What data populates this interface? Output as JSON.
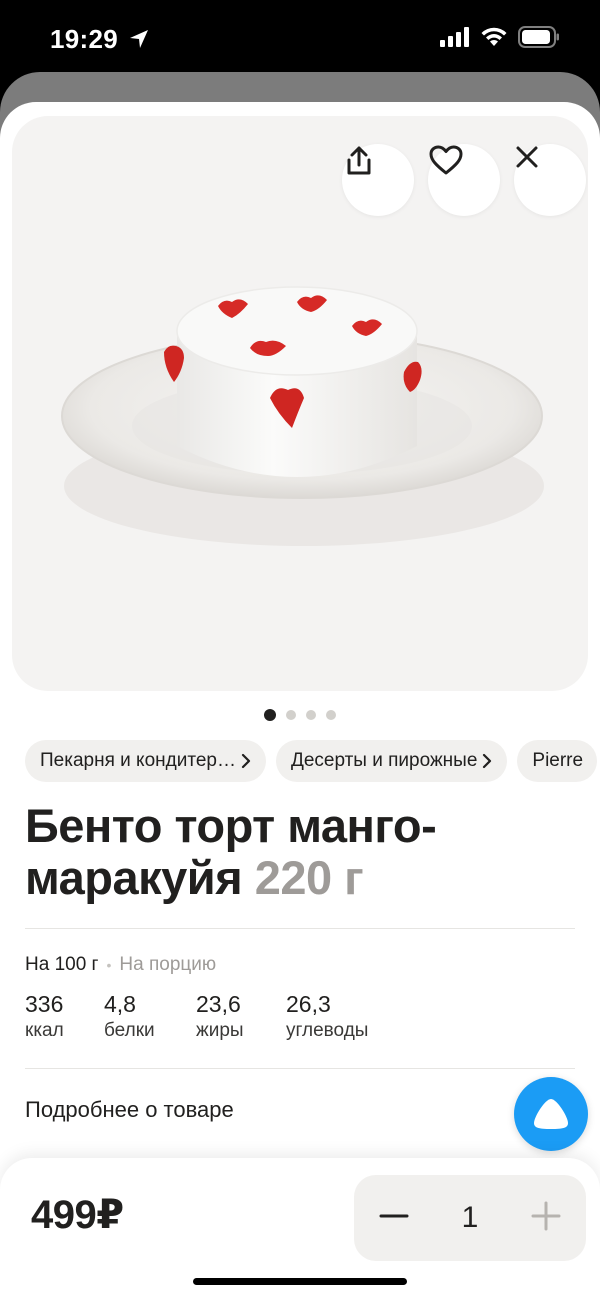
{
  "status": {
    "time": "19:29"
  },
  "product": {
    "breadcrumbs": [
      "Пекарня и кондитер…",
      "Десерты и пирожные",
      "Pierre"
    ],
    "title": "Бенто торт манго-маракуйя",
    "weight": "220 г",
    "pager": {
      "count": 4,
      "active": 1
    }
  },
  "nutrition": {
    "tab_active": "На 100 г",
    "tab_inactive": "На порцию",
    "items": [
      {
        "value": "336",
        "label": "ккал"
      },
      {
        "value": "4,8",
        "label": "белки"
      },
      {
        "value": "23,6",
        "label": "жиры"
      },
      {
        "value": "26,3",
        "label": "углеводы"
      }
    ]
  },
  "details_link": "Подробнее о товаре",
  "cart": {
    "price": "499₽",
    "quantity": "1"
  },
  "icons": [
    "location-arrow-icon",
    "signal-icon",
    "wifi-icon",
    "battery-icon",
    "share-icon",
    "heart-icon",
    "close-icon",
    "chevron-right-icon",
    "alice-icon",
    "minus-icon",
    "plus-icon"
  ],
  "colors": {
    "accent": "#1b9cf5",
    "chip_bg": "#f1f0ee",
    "muted": "#9e9b98"
  }
}
